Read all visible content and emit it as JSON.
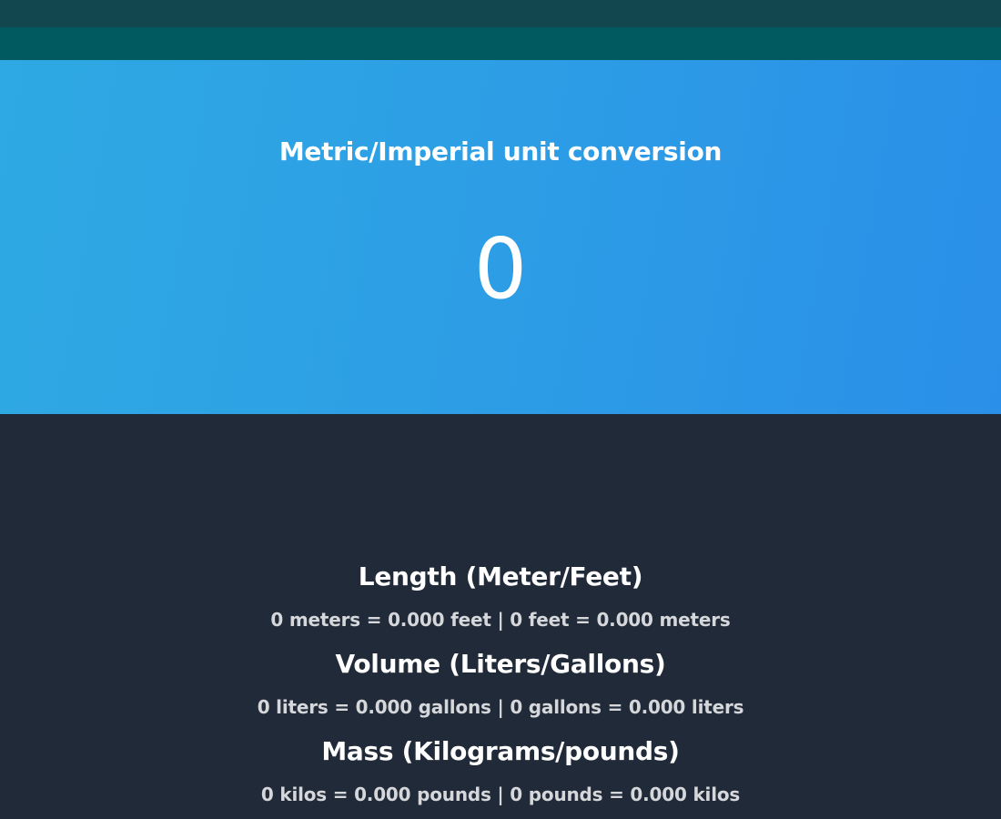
{
  "header": {
    "title": "Metric/Imperial unit conversion",
    "input_value": "0"
  },
  "sections": [
    {
      "title": "Length (Meter/Feet)",
      "result": "0 meters = 0.000 feet | 0 feet = 0.000 meters"
    },
    {
      "title": "Volume (Liters/Gallons)",
      "result": "0 liters = 0.000 gallons | 0 gallons = 0.000 liters"
    },
    {
      "title": "Mass (Kilograms/pounds)",
      "result": "0 kilos = 0.000 pounds | 0 pounds = 0.000 kilos"
    }
  ],
  "colors": {
    "top_strip_dark": "#12474f",
    "top_strip_teal": "#005a60",
    "hero_blue": "#2d9fe5",
    "content_bg": "#212a38"
  }
}
